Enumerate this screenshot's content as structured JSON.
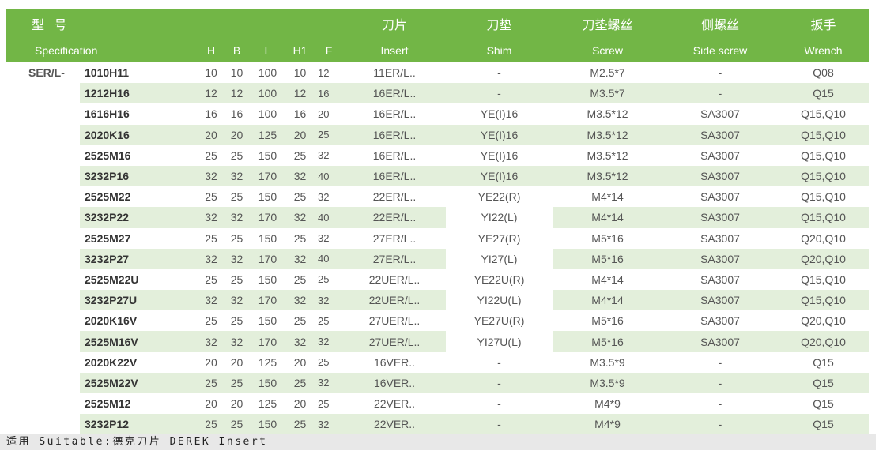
{
  "header": {
    "model_zh": "型 号",
    "model_en": "Specification",
    "col_h": "H",
    "col_b": "B",
    "col_l": "L",
    "col_h1": "H1",
    "col_f": "F",
    "insert_zh": "刀片",
    "insert_en": "Insert",
    "shim_zh": "刀垫",
    "shim_en": "Shim",
    "screw_zh": "刀垫螺丝",
    "screw_en": "Screw",
    "side_zh": "侧螺丝",
    "side_en": "Side screw",
    "wrench_zh": "扳手",
    "wrench_en": "Wrench"
  },
  "series": "SER/L-",
  "rows": [
    {
      "model": "1010H11",
      "h": "10",
      "b": "10",
      "l": "100",
      "h1": "10",
      "f": "12",
      "insert": "11ER/L..",
      "shim": "-",
      "screw": "M2.5*7",
      "side": "-",
      "wrench": "Q08"
    },
    {
      "model": "1212H16",
      "h": "12",
      "b": "12",
      "l": "100",
      "h1": "12",
      "f": "16",
      "insert": "16ER/L..",
      "shim": "-",
      "screw": "M3.5*7",
      "side": "-",
      "wrench": "Q15"
    },
    {
      "model": "1616H16",
      "h": "16",
      "b": "16",
      "l": "100",
      "h1": "16",
      "f": "20",
      "insert": "16ER/L..",
      "shim": "YE(I)16",
      "screw": "M3.5*12",
      "side": "SA3007",
      "wrench": "Q15,Q10"
    },
    {
      "model": "2020K16",
      "h": "20",
      "b": "20",
      "l": "125",
      "h1": "20",
      "f": "25",
      "insert": "16ER/L..",
      "shim": "YE(I)16",
      "screw": "M3.5*12",
      "side": "SA3007",
      "wrench": "Q15,Q10"
    },
    {
      "model": "2525M16",
      "h": "25",
      "b": "25",
      "l": "150",
      "h1": "25",
      "f": "32",
      "insert": "16ER/L..",
      "shim": "YE(I)16",
      "screw": "M3.5*12",
      "side": "SA3007",
      "wrench": "Q15,Q10"
    },
    {
      "model": "3232P16",
      "h": "32",
      "b": "32",
      "l": "170",
      "h1": "32",
      "f": "40",
      "insert": "16ER/L..",
      "shim": "YE(I)16",
      "screw": "M3.5*12",
      "side": "SA3007",
      "wrench": "Q15,Q10"
    },
    {
      "model": "2525M22",
      "h": "25",
      "b": "25",
      "l": "150",
      "h1": "25",
      "f": "32",
      "insert": "22ER/L..",
      "shim": "YE22(R)",
      "screw": "M4*14",
      "side": "SA3007",
      "wrench": "Q15,Q10"
    },
    {
      "model": "3232P22",
      "h": "32",
      "b": "32",
      "l": "170",
      "h1": "32",
      "f": "40",
      "insert": "22ER/L..",
      "shim": "YI22(L)",
      "screw": "M4*14",
      "side": "SA3007",
      "wrench": "Q15,Q10"
    },
    {
      "model": "2525M27",
      "h": "25",
      "b": "25",
      "l": "150",
      "h1": "25",
      "f": "32",
      "insert": "27ER/L..",
      "shim": "YE27(R)",
      "screw": "M5*16",
      "side": "SA3007",
      "wrench": "Q20,Q10"
    },
    {
      "model": "3232P27",
      "h": "32",
      "b": "32",
      "l": "170",
      "h1": "32",
      "f": "40",
      "insert": "27ER/L..",
      "shim": "YI27(L)",
      "screw": "M5*16",
      "side": "SA3007",
      "wrench": "Q20,Q10"
    },
    {
      "model": "2525M22U",
      "h": "25",
      "b": "25",
      "l": "150",
      "h1": "25",
      "f": "25",
      "insert": "22UER/L..",
      "shim": "YE22U(R)",
      "screw": "M4*14",
      "side": "SA3007",
      "wrench": "Q15,Q10"
    },
    {
      "model": "3232P27U",
      "h": "32",
      "b": "32",
      "l": "170",
      "h1": "32",
      "f": "32",
      "insert": "22UER/L..",
      "shim": "YI22U(L)",
      "screw": "M4*14",
      "side": "SA3007",
      "wrench": "Q15,Q10"
    },
    {
      "model": "2020K16V",
      "h": "25",
      "b": "25",
      "l": "150",
      "h1": "25",
      "f": "25",
      "insert": "27UER/L..",
      "shim": "YE27U(R)",
      "screw": "M5*16",
      "side": "SA3007",
      "wrench": "Q20,Q10"
    },
    {
      "model": "2525M16V",
      "h": "32",
      "b": "32",
      "l": "170",
      "h1": "32",
      "f": "32",
      "insert": "27UER/L..",
      "shim": "YI27U(L)",
      "screw": "M5*16",
      "side": "SA3007",
      "wrench": "Q20,Q10"
    },
    {
      "model": "2020K22V",
      "h": "20",
      "b": "20",
      "l": "125",
      "h1": "20",
      "f": "25",
      "insert": "16VER..",
      "shim": "-",
      "screw": "M3.5*9",
      "side": "-",
      "wrench": "Q15"
    },
    {
      "model": "2525M22V",
      "h": "25",
      "b": "25",
      "l": "150",
      "h1": "25",
      "f": "32",
      "insert": "16VER..",
      "shim": "-",
      "screw": "M3.5*9",
      "side": "-",
      "wrench": "Q15"
    },
    {
      "model": "2525M12",
      "h": "20",
      "b": "20",
      "l": "125",
      "h1": "20",
      "f": "25",
      "insert": "22VER..",
      "shim": "-",
      "screw": "M4*9",
      "side": "-",
      "wrench": "Q15"
    },
    {
      "model": "3232P12",
      "h": "25",
      "b": "25",
      "l": "150",
      "h1": "25",
      "f": "32",
      "insert": "22VER..",
      "shim": "-",
      "screw": "M4*9",
      "side": "-",
      "wrench": "Q15"
    }
  ],
  "footer": "适用 Suitable:德克刀片 DEREK Insert"
}
